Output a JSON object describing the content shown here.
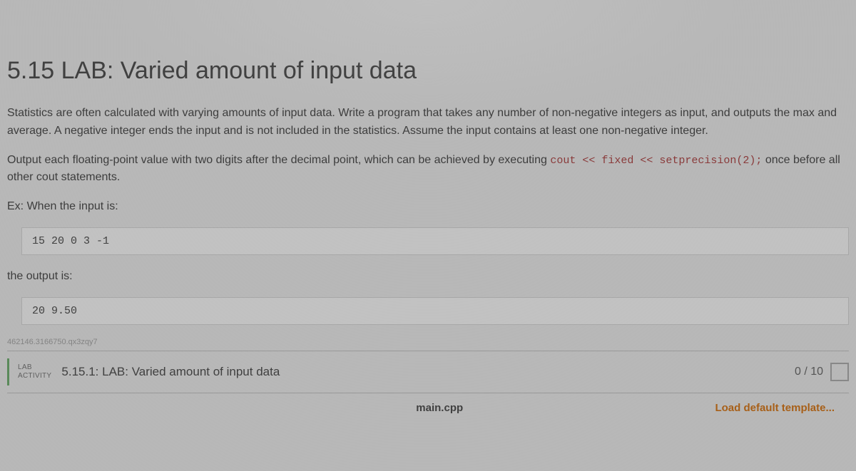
{
  "title": "5.15 LAB: Varied amount of input data",
  "para1_a": "Statistics are often calculated with varying amounts of input data. Write a program that takes any number of non-negative integers as input, and outputs the max and average. A negative integer ends the input and is not included in the statistics. Assume the input contains at least one non-negative integer.",
  "para2_a": "Output each floating-point value with two digits after the decimal point, which can be achieved by executing ",
  "para2_code": "cout << fixed << setprecision(2);",
  "para2_b": " once before all other cout statements.",
  "ex_label": "Ex: When the input is:",
  "input_block": "15 20 0 3 -1",
  "output_label": "the output is:",
  "output_block": "20 9.50",
  "watermark": "462146.3166750.qx3zqy7",
  "activity": {
    "label_top": "LAB",
    "label_bottom": "ACTIVITY",
    "title": "5.15.1: LAB: Varied amount of input data",
    "score": "0 / 10"
  },
  "file_bar": {
    "filename": "main.cpp",
    "load_template": "Load default template..."
  }
}
